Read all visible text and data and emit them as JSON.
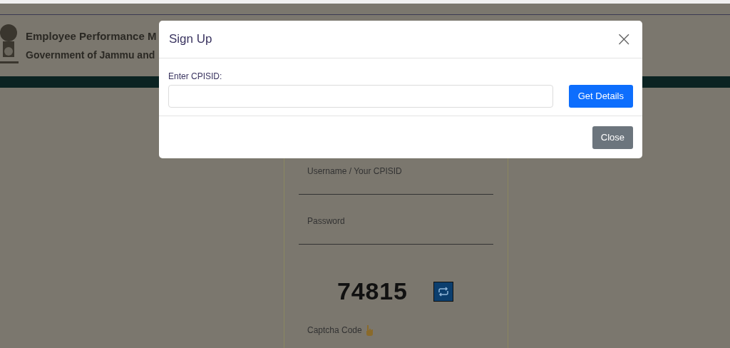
{
  "header": {
    "title": "Employee Performance M",
    "subtitle": "Government of Jammu and"
  },
  "login": {
    "username_label": "Username / Your CPISID",
    "password_label": "Password",
    "captcha": "74815",
    "captcha_label": "Captcha Code"
  },
  "modal": {
    "title": "Sign Up",
    "close_icon": "×",
    "field_label": "Enter CPISID:",
    "buttons": [
      {
        "label": "Get Details",
        "kind": "primary"
      },
      {
        "label": "Close",
        "kind": "secondary"
      }
    ]
  }
}
